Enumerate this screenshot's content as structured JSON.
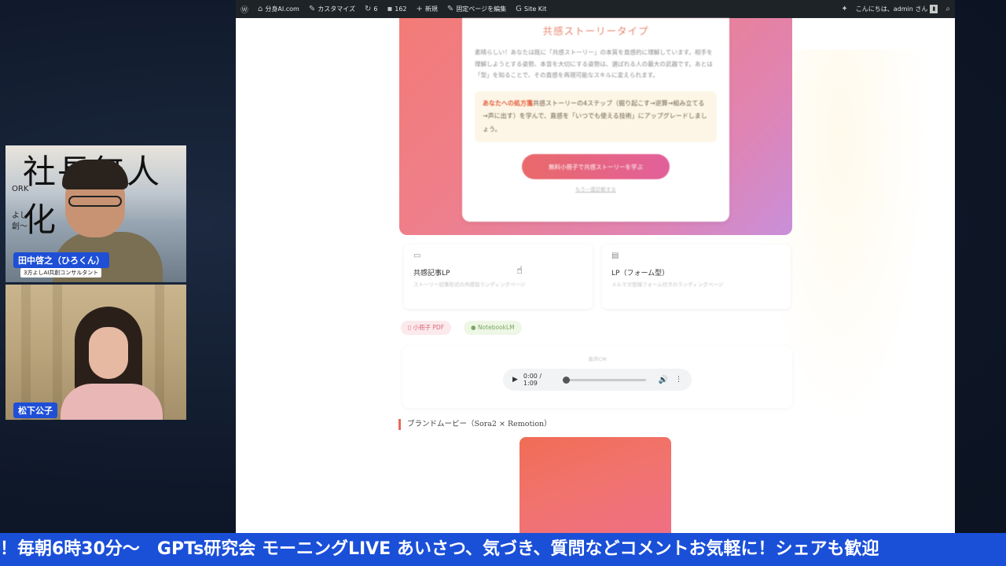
{
  "admin_bar": {
    "wp_icon": "wordpress-logo-icon",
    "site_name": "分身AI.com",
    "customize": "カスタマイズ",
    "updates_count": "6",
    "comments_count": "162",
    "new_label": "新規",
    "edit_label": "固定ページを編集",
    "site_kit": "Site Kit",
    "greeting": "こんにちは、admin さん"
  },
  "hero": {
    "title": "共感ストーリータイプ",
    "body": "素晴らしい！あなたは既に「共感ストーリー」の本質を直感的に理解しています。相手を理解しようとする姿勢、本音を大切にする姿勢は、選ばれる人の最大の武器です。あとは「型」を知ることで、その直感を再現可能なスキルに変えられます。",
    "rx_label": "あなたへの処方箋",
    "rx_text": "共感ストーリーの4ステップ（掘り起こす→逆算→組み立てる→声に出す）を学んで、直感を「いつでも使える技術」にアップグレードしましょう。",
    "cta": "無料小冊子で共感ストーリーを学ぶ",
    "sub_link": "もう一度診断する"
  },
  "lp_cards": [
    {
      "icon": "book-icon",
      "title": "共感記事LP",
      "desc": "ストーリー記事形式の共感型ランディングページ"
    },
    {
      "icon": "memo-icon",
      "title": "LP（フォーム型）",
      "desc": "メルマガ登録フォーム付きのランディングページ"
    }
  ],
  "chips": {
    "pdf": "小冊子 PDF",
    "notebook": "NotebookLM"
  },
  "audio": {
    "label": "音声CM",
    "time": "0:00 / 1:09",
    "progress": 0
  },
  "brand": {
    "heading": "ブランドムービー（Sora2 × Remotion）"
  },
  "cams": {
    "host_name": "田中啓之（ひろくん）",
    "host_title": "3方よしAI共創コンサルタント",
    "host_bg_text": "社長無人化",
    "host_bg_side1": "ORK",
    "host_bg_side2": "よし",
    "host_bg_side3": "創〜",
    "guest_name": "松下公子"
  },
  "ticker": {
    "text": "！毎朝6時30分〜　GPTs研究会 モーニングLIVE あいさつ、気づき、質問などコメントお気軽に！シェアも歓迎"
  }
}
